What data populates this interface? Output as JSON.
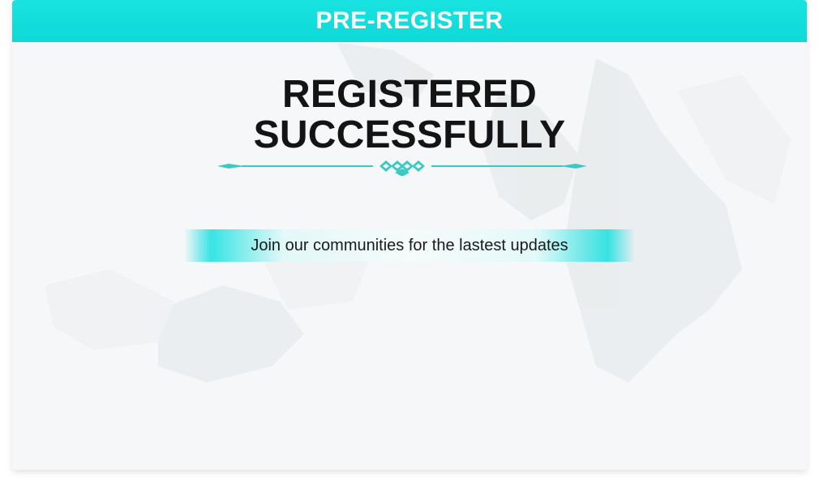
{
  "header": {
    "title": "PRE-REGISTER"
  },
  "main": {
    "title_line1": "REGISTERED",
    "title_line2": "SUCCESSFULLY",
    "message": "Join our communities for the lastest updates"
  },
  "colors": {
    "accent": "#0ed9d8",
    "title_text": "#141414",
    "ornament": "#3cc9c6"
  }
}
